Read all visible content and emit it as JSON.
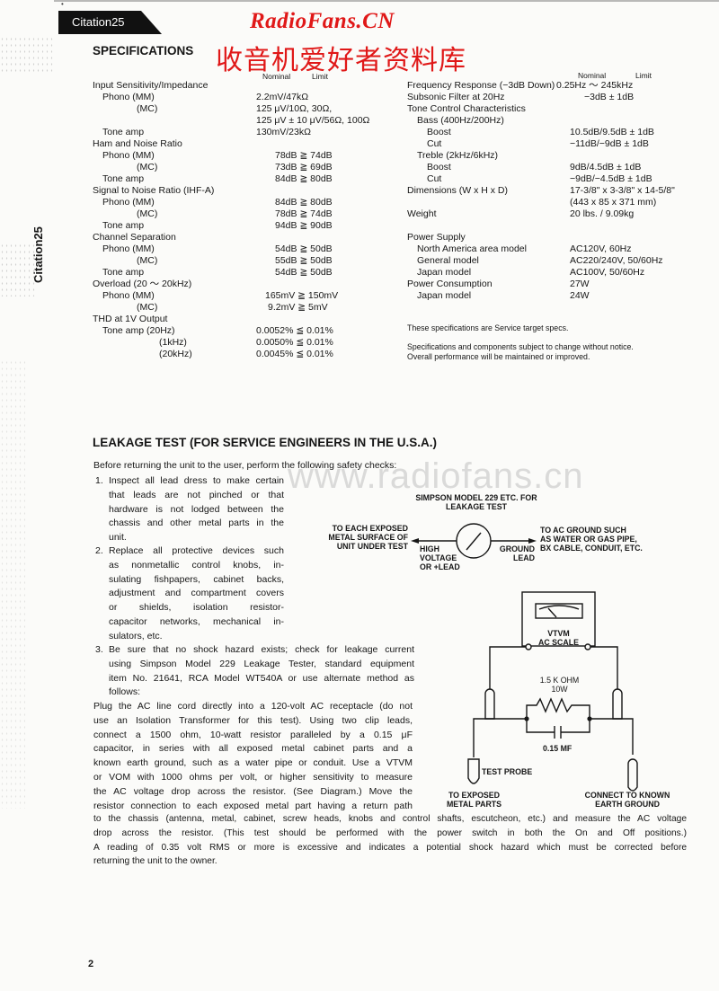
{
  "header": {
    "model_tab": "Citation25",
    "side_label": "Citation25",
    "watermark_en": "RadioFans.CN",
    "watermark_cn": "收音机爱好者资料库",
    "watermark_url": "www.radiofans.cn",
    "corner_mark": "•"
  },
  "specifications": {
    "title": "SPECIFICATIONS",
    "left_headers": {
      "nominal": "Nominal",
      "limit": "Limit"
    },
    "right_headers": {
      "nominal": "Nominal",
      "limit": "Limit"
    },
    "left_rows": [
      {
        "label": "Input Sensitivity/Impedance",
        "value": ""
      },
      {
        "label": "Phono (MM)",
        "value": "2.2mV/47kΩ"
      },
      {
        "label": "(MC)",
        "value": "125 μV/10Ω, 30Ω,"
      },
      {
        "label": "",
        "value": "125 μV ± 10 μV/56Ω, 100Ω"
      },
      {
        "label": "Tone amp",
        "value": "130mV/23kΩ"
      },
      {
        "label": "Ham and Noise Ratio",
        "value": ""
      },
      {
        "label": "Phono (MM)",
        "value": "78dB ≧ 74dB"
      },
      {
        "label": "(MC)",
        "value": "73dB ≧ 69dB"
      },
      {
        "label": "Tone amp",
        "value": "84dB ≧ 80dB"
      },
      {
        "label": "Signal to Noise Ratio (IHF-A)",
        "value": ""
      },
      {
        "label": "Phono (MM)",
        "value": "84dB ≧ 80dB"
      },
      {
        "label": "(MC)",
        "value": "78dB ≧ 74dB"
      },
      {
        "label": "Tone amp",
        "value": "94dB ≧ 90dB"
      },
      {
        "label": "Channel Separation",
        "value": ""
      },
      {
        "label": "Phono (MM)",
        "value": "54dB ≧ 50dB"
      },
      {
        "label": "(MC)",
        "value": "55dB ≧ 50dB"
      },
      {
        "label": "Tone amp",
        "value": "54dB ≧ 50dB"
      },
      {
        "label": "Overload (20 ～ 20kHz)",
        "value": ""
      },
      {
        "label": "Phono (MM)",
        "value": "165mV ≧ 150mV"
      },
      {
        "label": "(MC)",
        "value": "9.2mV ≧ 5mV"
      },
      {
        "label": "THD at 1V Output",
        "value": ""
      },
      {
        "label": "Tone amp (20Hz)",
        "value": "0.0052% ≦ 0.01%"
      },
      {
        "label": "(1kHz)",
        "value": "0.0050% ≦ 0.01%"
      },
      {
        "label": "(20kHz)",
        "value": "0.0045% ≦ 0.01%"
      }
    ],
    "right_rows": [
      {
        "label": "Frequency Response (−3dB Down)",
        "value": "0.25Hz ～ 245kHz"
      },
      {
        "label": "Subsonic Filter at 20Hz",
        "value": "−3dB ± 1dB"
      },
      {
        "label": "Tone Control Characteristics",
        "value": ""
      },
      {
        "label": "Bass (400Hz/200Hz)",
        "value": ""
      },
      {
        "label": "Boost",
        "value": "10.5dB/9.5dB ± 1dB"
      },
      {
        "label": "Cut",
        "value": "−11dB/−9dB ± 1dB"
      },
      {
        "label": "Treble (2kHz/6kHz)",
        "value": ""
      },
      {
        "label": "Boost",
        "value": "9dB/4.5dB ± 1dB"
      },
      {
        "label": "Cut",
        "value": "−9dB/−4.5dB ± 1dB"
      },
      {
        "label": "Dimensions (W x H x D)",
        "value": "17-3/8\" x 3-3/8\" x 14-5/8\""
      },
      {
        "label": "",
        "value": "(443 x 85 x 371 mm)"
      },
      {
        "label": "Weight",
        "value": "20 lbs. / 9.09kg"
      },
      {
        "label": "",
        "value": ""
      },
      {
        "label": "Power Supply",
        "value": ""
      },
      {
        "label": "North America area model",
        "value": "AC120V, 60Hz"
      },
      {
        "label": "General model",
        "value": "AC220/240V, 50/60Hz"
      },
      {
        "label": "Japan model",
        "value": "AC100V, 50/60Hz"
      },
      {
        "label": "Power Consumption",
        "value": "27W"
      },
      {
        "label": "Japan model",
        "value": "24W"
      }
    ],
    "notes": [
      "These specifications are Service target specs.",
      "Specifications and components subject to change without notice.",
      "Overall performance will be maintained or improved."
    ]
  },
  "leakage": {
    "title": "LEAKAGE TEST (FOR SERVICE ENGINEERS IN THE U.S.A.)",
    "intro": "Before returning the unit to the user, perform the following safety checks:",
    "item1": {
      "num": "1.",
      "lines": [
        "Inspect all lead dress to make certain",
        "that leads are not pinched or that",
        "hardware is not lodged between the",
        "chassis and other metal parts in the",
        "unit."
      ]
    },
    "item2": {
      "num": "2.",
      "lines": [
        "Replace all protective devices such",
        "as nonmetallic control knobs, in-",
        "sulating fishpapers, cabinet backs,",
        "adjustment and compartment covers",
        "or shields, isolation resistor-",
        "capacitor networks, mechanical in-",
        "sulators, etc."
      ]
    },
    "item3": {
      "num": "3.",
      "lines": [
        "Be sure that no shock hazard exists; check for leakage current",
        "using Simpson Model 229 Leakage Tester, standard equipment",
        "item No. 21641, RCA Model WT540A or use alternate method as",
        "follows:"
      ]
    },
    "body_lines": [
      "Plug the AC line cord directly into a 120-volt AC receptacle (do not",
      "use an Isolation Transformer for this test). Using two clip leads,",
      "connect a 1500 ohm, 10-watt resistor paralleled by a 0.15 μF",
      "capacitor, in series with all exposed metal cabinet parts and a",
      "known earth ground, such as a water pipe or conduit. Use a VTVM",
      "or VOM with 1000 ohms per volt, or higher sensitivity to measure",
      "the AC voltage drop across the resistor. (See Diagram.) Move the",
      "resistor connection to each exposed metal part having a return path"
    ],
    "wide_lines": [
      "to the chassis (antenna, metal, cabinet, screw heads, knobs and control shafts, escutcheon, etc.) and measure the AC voltage",
      "drop across the resistor. (This test should be performed with the power switch in both the On and Off positions.)",
      "A reading of 0.35 volt RMS or more is excessive and indicates a potential shock hazard which must be corrected before",
      "returning the unit to the owner."
    ]
  },
  "diagram1": {
    "title": [
      "SIMPSON MODEL 229 ETC. FOR",
      "LEAKAGE TEST"
    ],
    "left_label": [
      "TO EACH EXPOSED",
      "METAL SURFACE OF",
      "UNIT UNDER TEST"
    ],
    "high_label": [
      "HIGH",
      "VOLTAGE",
      "OR +LEAD"
    ],
    "ground_label": [
      "GROUND",
      "LEAD"
    ],
    "right_label": [
      "TO AC GROUND SUCH",
      "AS WATER OR GAS PIPE,",
      "BX CABLE, CONDUIT, ETC."
    ]
  },
  "diagram2": {
    "meter_label": [
      "VTVM",
      "AC SCALE"
    ],
    "resistor_label": [
      "1.5 K OHM",
      "10W"
    ],
    "capacitor_label": "0.15 MF",
    "probe_label": "TEST PROBE",
    "left_bottom": [
      "TO EXPOSED",
      "METAL PARTS"
    ],
    "right_bottom": [
      "CONNECT TO KNOWN",
      "EARTH GROUND"
    ]
  },
  "footer": {
    "page_number": "2"
  }
}
